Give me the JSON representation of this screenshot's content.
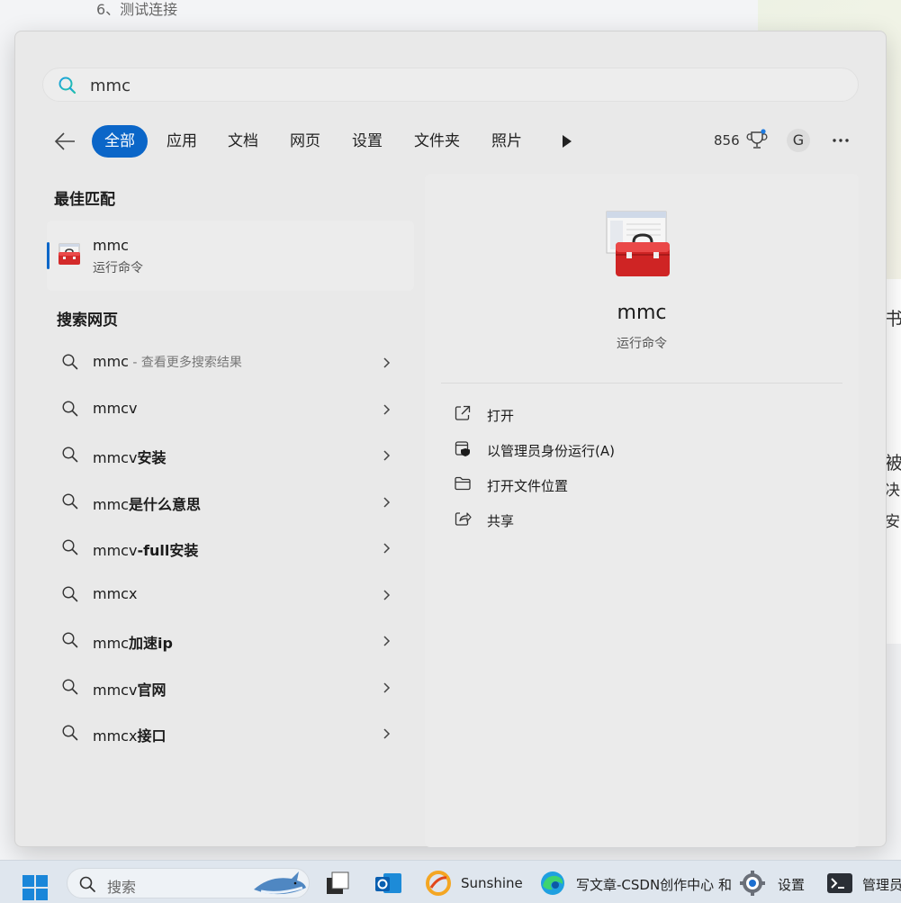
{
  "background": {
    "top_text": "6、测试连接",
    "side_chars": [
      "书",
      "被",
      "决",
      "安"
    ]
  },
  "search": {
    "query": "mmc"
  },
  "filters": {
    "tabs": [
      {
        "label": "全部",
        "active": true
      },
      {
        "label": "应用"
      },
      {
        "label": "文档"
      },
      {
        "label": "网页"
      },
      {
        "label": "设置"
      },
      {
        "label": "文件夹"
      },
      {
        "label": "照片"
      }
    ],
    "points": "856",
    "avatar_letter": "G"
  },
  "best_match": {
    "section_title": "最佳匹配",
    "title": "mmc",
    "subtitle": "运行命令"
  },
  "web_search": {
    "section_title": "搜索网页",
    "items": [
      {
        "prefix": "mmc",
        "bold": "",
        "hint": " - 查看更多搜索结果"
      },
      {
        "prefix": "mmcv",
        "bold": "",
        "hint": ""
      },
      {
        "prefix": "mmcv",
        "bold": "安装",
        "hint": ""
      },
      {
        "prefix": "mmc",
        "bold": "是什么意思",
        "hint": ""
      },
      {
        "prefix": "mmcv",
        "bold": "-full安装",
        "hint": ""
      },
      {
        "prefix": "mmcx",
        "bold": "",
        "hint": ""
      },
      {
        "prefix": "mmc",
        "bold": "加速ip",
        "hint": ""
      },
      {
        "prefix": "mmcv",
        "bold": "官网",
        "hint": ""
      },
      {
        "prefix": "mmcx",
        "bold": "接口",
        "hint": ""
      }
    ]
  },
  "detail": {
    "name": "mmc",
    "kind": "运行命令",
    "actions": [
      {
        "label": "打开",
        "icon": "open-external-icon"
      },
      {
        "label": "以管理员身份运行(A)",
        "icon": "admin-shield-icon"
      },
      {
        "label": "打开文件位置",
        "icon": "folder-icon"
      },
      {
        "label": "共享",
        "icon": "share-icon"
      }
    ]
  },
  "taskbar": {
    "search_placeholder": "搜索",
    "apps": [
      {
        "label": "Sunshine"
      },
      {
        "label": "写文章-CSDN创作中心 和"
      },
      {
        "label": "设置"
      },
      {
        "label": "管理员"
      }
    ]
  },
  "colors": {
    "accent": "#0b66c8",
    "panel": "#e9e9e9",
    "taskbar": "#dfe6ee"
  }
}
